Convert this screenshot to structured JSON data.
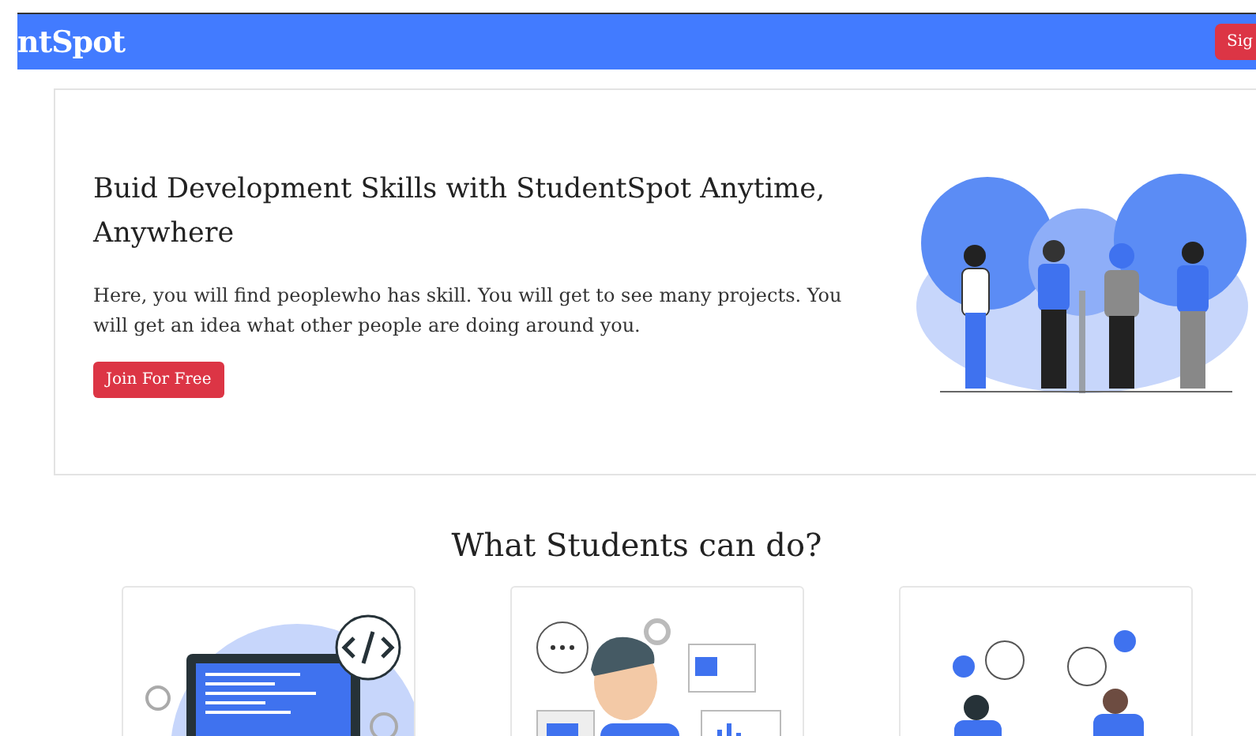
{
  "navbar": {
    "brand": "ntSpot",
    "button": "Sig"
  },
  "hero": {
    "title": "Buid Development Skills with StudentSpot Anytime, Anywhere",
    "text": "Here, you will find peoplewho has skill. You will get to see many projects. You will get an idea what other people are doing around you.",
    "button": "Join For Free"
  },
  "section": {
    "title": "What Students can do?"
  },
  "cards": [
    {
      "kind": "code"
    },
    {
      "kind": "media"
    },
    {
      "kind": "chat"
    }
  ]
}
